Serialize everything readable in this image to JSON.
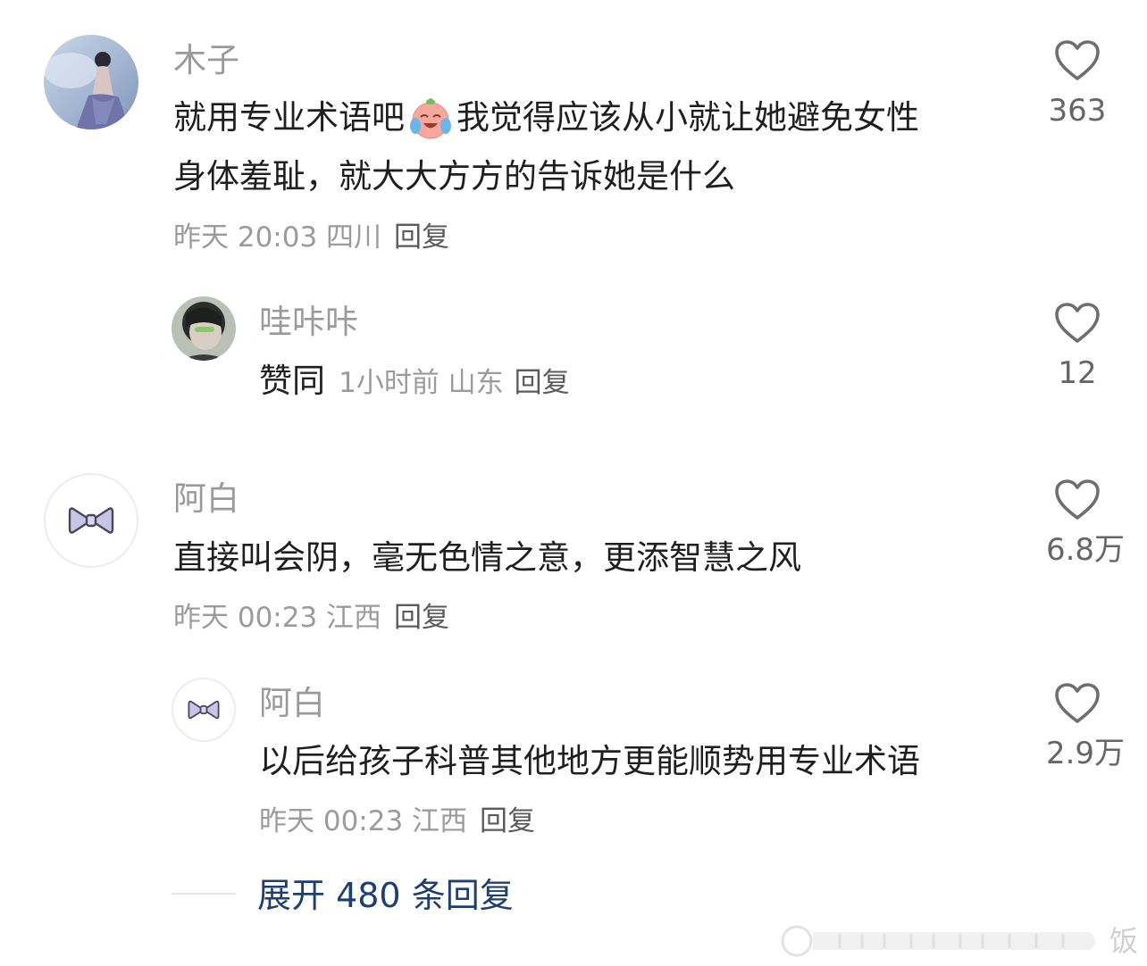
{
  "comments": [
    {
      "author": "木子",
      "content_before_emoji": "就用专业术语吧",
      "emoji": "crying-laughing-emoji",
      "content_after_emoji": "我觉得应该从小就让她避免女性",
      "content_line2": "身体羞耻，就大大方方的告诉她是什么",
      "meta": "昨天 20:03 四川",
      "reply_label": "回复",
      "likes": "363",
      "replies": [
        {
          "author": "哇咔咔",
          "content": "赞同",
          "meta": "1小时前 山东",
          "reply_label": "回复",
          "likes": "12"
        }
      ]
    },
    {
      "author": "阿白",
      "content": "直接叫会阴，毫无色情之意，更添智慧之风",
      "meta": "昨天 00:23 江西",
      "reply_label": "回复",
      "likes": "6.8万",
      "replies": [
        {
          "author": "阿白",
          "content": "以后给孩子科普其他地方更能顺势用专业术语",
          "meta": "昨天 00:23 江西",
          "reply_label": "回复",
          "likes": "2.9万"
        }
      ]
    }
  ],
  "expand_label": "展开 480 条回复",
  "watermark": "饭",
  "icons": {
    "like": "heart-outline-icon",
    "avatar_bow": "bow-icon"
  }
}
